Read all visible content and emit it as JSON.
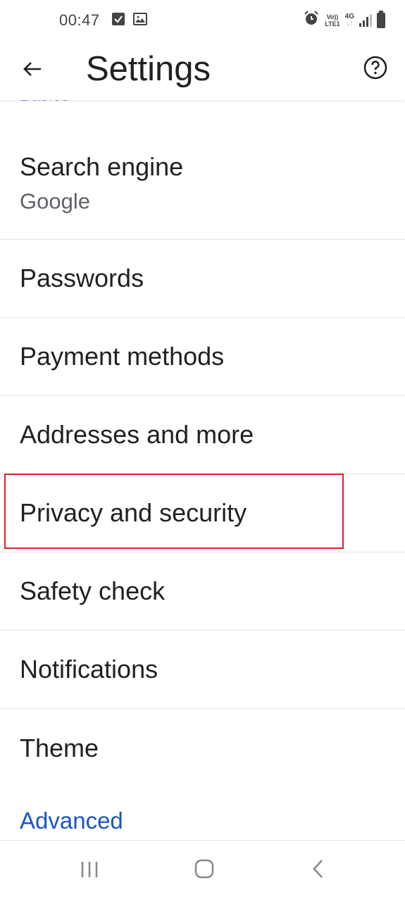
{
  "status_bar": {
    "time": "00:47",
    "left_icons": [
      "check-icon",
      "gallery-icon"
    ],
    "vo_lte": [
      "Vo))",
      "LTE1"
    ],
    "network": "4G",
    "right_icons": [
      "alarm-icon",
      "volte-icon",
      "4g-data-icon",
      "signal-icon",
      "battery-icon"
    ]
  },
  "toolbar": {
    "back_icon": "arrow-left-icon",
    "title": "Settings",
    "help_icon": "help-circle-icon"
  },
  "sections": {
    "basics_header": "Basics",
    "advanced_header": "Advanced"
  },
  "items": [
    {
      "title": "Search engine",
      "summary": "Google"
    },
    {
      "title": "Passwords"
    },
    {
      "title": "Payment methods"
    },
    {
      "title": "Addresses and more"
    },
    {
      "title": "Privacy and security",
      "highlighted": true
    },
    {
      "title": "Safety check"
    },
    {
      "title": "Notifications"
    },
    {
      "title": "Theme"
    }
  ],
  "highlight": {
    "color": "#e0202a",
    "target": "Privacy and security"
  },
  "accent_color": "#1a56c4",
  "nav_bar": {
    "icons": [
      "recents-icon",
      "home-icon",
      "back-icon"
    ]
  }
}
